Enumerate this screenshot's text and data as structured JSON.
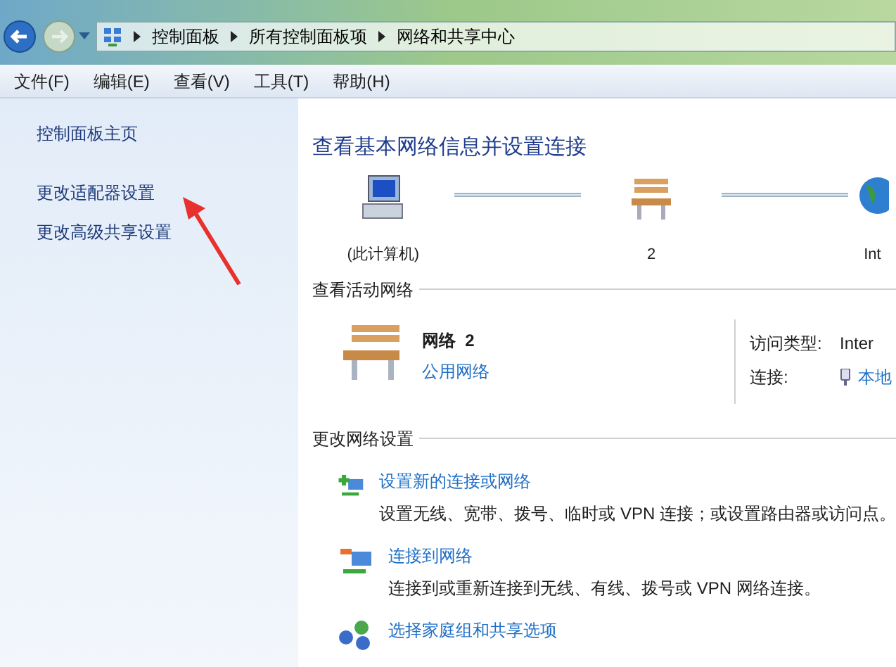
{
  "breadcrumb": [
    "控制面板",
    "所有控制面板项",
    "网络和共享中心"
  ],
  "menu": [
    "文件(F)",
    "编辑(E)",
    "查看(V)",
    "工具(T)",
    "帮助(H)"
  ],
  "sidebar": {
    "items": [
      "控制面板主页",
      "更改适配器设置",
      "更改高级共享设置"
    ]
  },
  "main": {
    "title": "查看基本网络信息并设置连接",
    "network_map": [
      {
        "kind": "computer",
        "label": "(此计算机)"
      },
      {
        "kind": "network",
        "label": "2"
      },
      {
        "kind": "internet",
        "label": "Int"
      }
    ],
    "active_networks": {
      "heading": "查看活动网络",
      "name": "网络  2",
      "type_link": "公用网络",
      "props": [
        {
          "label": "访问类型:",
          "value": "Inter",
          "kind": "text"
        },
        {
          "label": "连接:",
          "value": "本地",
          "kind": "link"
        }
      ]
    },
    "change_settings": {
      "heading": "更改网络设置",
      "tasks": [
        {
          "kind": "new",
          "link": "设置新的连接或网络",
          "description": "设置无线、宽带、拨号、临时或 VPN 连接；或设置路由器或访问点。"
        },
        {
          "kind": "connect",
          "link": "连接到网络",
          "description": "连接到或重新连接到无线、有线、拨号或 VPN 网络连接。"
        },
        {
          "kind": "homegroup",
          "link": "选择家庭组和共享选项"
        }
      ]
    }
  }
}
